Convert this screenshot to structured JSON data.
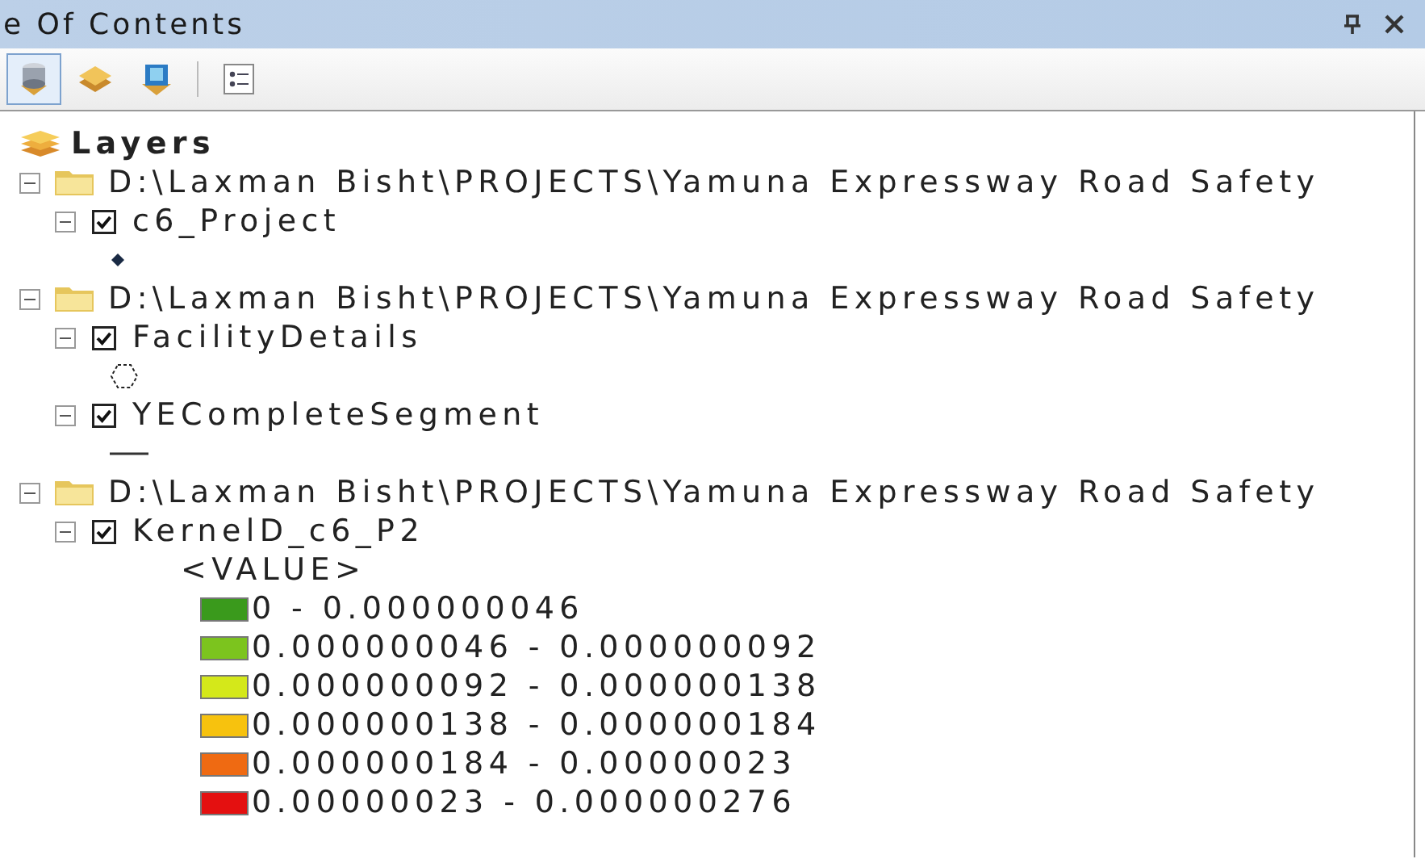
{
  "window": {
    "title": "e Of Contents"
  },
  "toolbar": [
    {
      "kind": "drawing-order",
      "selected": true
    },
    {
      "kind": "source",
      "selected": false
    },
    {
      "kind": "visibility",
      "selected": false
    },
    {
      "kind": "options",
      "selected": false
    }
  ],
  "root": {
    "label": "Layers"
  },
  "groups": [
    {
      "label": "D:\\Laxman Bisht\\PROJECTS\\Yamuna Expressway Road Safety",
      "expanded": true,
      "layers": [
        {
          "label": "c6_Project",
          "checked": true,
          "expanded": true,
          "symbol": {
            "kind": "point"
          }
        }
      ]
    },
    {
      "label": "D:\\Laxman Bisht\\PROJECTS\\Yamuna Expressway Road Safety",
      "expanded": true,
      "layers": [
        {
          "label": "FacilityDetails",
          "checked": true,
          "expanded": true,
          "symbol": {
            "kind": "polygon"
          }
        },
        {
          "label": "YECompleteSegment",
          "checked": true,
          "expanded": true,
          "symbol": {
            "kind": "line"
          }
        }
      ]
    },
    {
      "label": "D:\\Laxman Bisht\\PROJECTS\\Yamuna Expressway Road Safety",
      "expanded": true,
      "layers": [
        {
          "label": "KernelD_c6_P2",
          "checked": true,
          "expanded": true,
          "symbol": {
            "kind": "classes",
            "field": "<VALUE>",
            "classes": [
              {
                "label": "0 - 0.000000046",
                "color": "#3a9a1c"
              },
              {
                "label": "0.000000046 - 0.000000092",
                "color": "#7cc41e"
              },
              {
                "label": "0.000000092 - 0.000000138",
                "color": "#d4e81a"
              },
              {
                "label": "0.000000138 - 0.000000184",
                "color": "#f7c20e"
              },
              {
                "label": "0.000000184 - 0.00000023",
                "color": "#ef6a12"
              },
              {
                "label": "0.00000023 - 0.000000276",
                "color": "#e41010"
              }
            ]
          }
        }
      ]
    }
  ]
}
